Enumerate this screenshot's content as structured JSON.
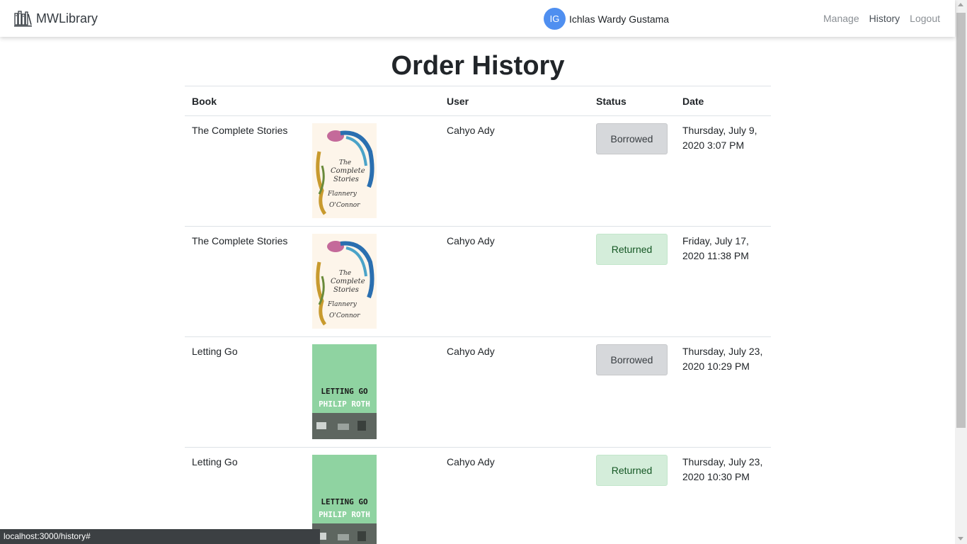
{
  "navbar": {
    "brand": "MWLibrary",
    "brand_icon": "library-icon",
    "user": {
      "initials": "IG",
      "name": "Ichlas Wardy Gustama",
      "avatar_color": "#4f8ff0"
    },
    "links": [
      "Manage",
      "History",
      "Logout"
    ]
  },
  "page": {
    "title": "Order History"
  },
  "table": {
    "headers": [
      "Book",
      "User",
      "Status",
      "Date"
    ],
    "rows": [
      {
        "book": "The Complete Stories",
        "cover": {
          "title_lines": [
            "The",
            "Complete",
            "Stories",
            "Flannery",
            "O'Connor"
          ],
          "bg": "#fdf5ea"
        },
        "user": "Cahyo Ady",
        "status": "Borrowed",
        "date": "Thursday, July 9, 2020 3:07 PM"
      },
      {
        "book": "The Complete Stories",
        "cover": {
          "title_lines": [
            "The",
            "Complete",
            "Stories",
            "Flannery",
            "O'Connor"
          ],
          "bg": "#fdf5ea"
        },
        "user": "Cahyo Ady",
        "status": "Returned",
        "date": "Friday, July 17, 2020 11:38 PM"
      },
      {
        "book": "Letting Go",
        "cover": {
          "title_lines": [
            "LETTING GO",
            "PHILIP ROTH"
          ],
          "bg": "#8fd3a1"
        },
        "user": "Cahyo Ady",
        "status": "Borrowed",
        "date": "Thursday, July 23, 2020 10:29 PM"
      },
      {
        "book": "Letting Go",
        "cover": {
          "title_lines": [
            "LETTING GO",
            "PHILIP ROTH"
          ],
          "bg": "#8fd3a1"
        },
        "user": "Cahyo Ady",
        "status": "Returned",
        "date": "Thursday, July 23, 2020 10:30 PM"
      }
    ]
  },
  "statusbar": {
    "url": "localhost:3000/history#"
  },
  "colors": {
    "borrowed_bg": "#d6d8db",
    "returned_bg": "#d4edda",
    "returned_text": "#155724"
  }
}
